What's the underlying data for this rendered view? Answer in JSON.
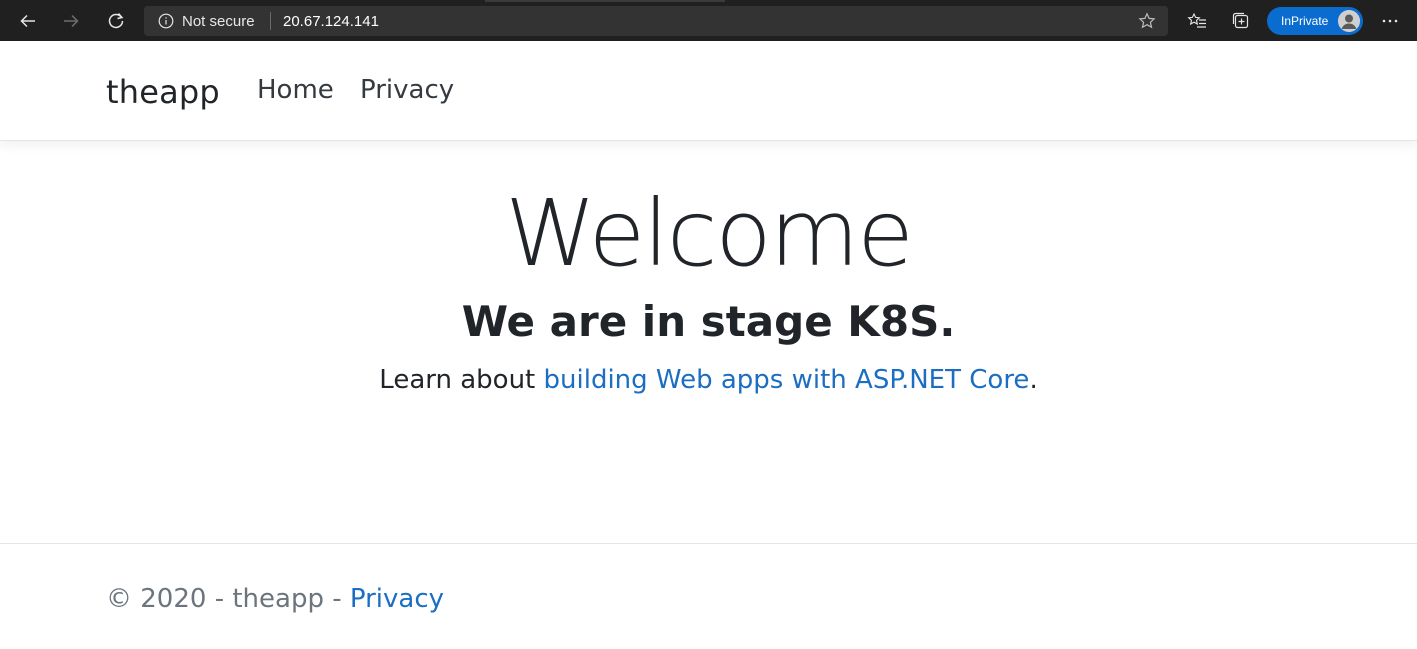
{
  "browser": {
    "security_label": "Not secure",
    "url": "20.67.124.141",
    "inprivate_label": "InPrivate"
  },
  "nav": {
    "brand": "theapp",
    "links": [
      "Home",
      "Privacy"
    ]
  },
  "main": {
    "heading": "Welcome",
    "subheading": "We are in stage K8S.",
    "learn_prefix": "Learn about ",
    "learn_link": "building Web apps with ASP.NET Core",
    "learn_suffix": "."
  },
  "footer": {
    "prefix": "© 2020 - theapp - ",
    "privacy_link": "Privacy"
  },
  "colors": {
    "link": "#1b6ec2",
    "chrome_bg": "#202020",
    "inprivate_badge": "#0a6cce"
  }
}
